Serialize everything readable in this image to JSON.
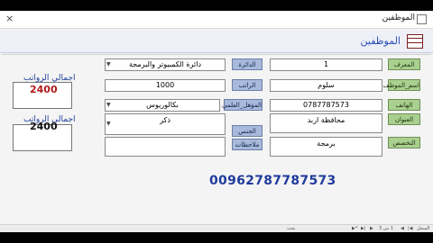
{
  "window": {
    "title": "الموظفين"
  },
  "form": {
    "title": "الموظفين"
  },
  "fields": {
    "employee_no": {
      "label": "المعرف",
      "value": "1"
    },
    "employee_name": {
      "label": "اسم_الموظف",
      "value": "سلوم"
    },
    "phone": {
      "label": "الهاتف",
      "value": "0787787573"
    },
    "address": {
      "label": "العنوان",
      "value": "محافظة اربد"
    },
    "specialization": {
      "label": "التخصص",
      "value": "برمجة"
    },
    "department": {
      "label": "الدائرة",
      "value": "دائرة الكمبيوتر والبرمجة"
    },
    "salary": {
      "label": "الراتب",
      "value": "1000"
    },
    "qualification": {
      "label": "المؤهل_العلمي",
      "value": "بكالوريوس"
    },
    "gender": {
      "label": "الجنس",
      "value": "ذكر"
    },
    "notes": {
      "label": "ملاحظات",
      "value": ""
    }
  },
  "totals": [
    {
      "label": "اجمالي الرواتب",
      "value": "2400",
      "color": "#b11b1b"
    },
    {
      "label": "اجمالي الرواتب",
      "value": "2400",
      "color": "#111111"
    }
  ],
  "phone_display": "00962787787573",
  "nav": {
    "record_label": "السجل",
    "record_pos": "1 من 3",
    "search_label": "بحث"
  }
}
